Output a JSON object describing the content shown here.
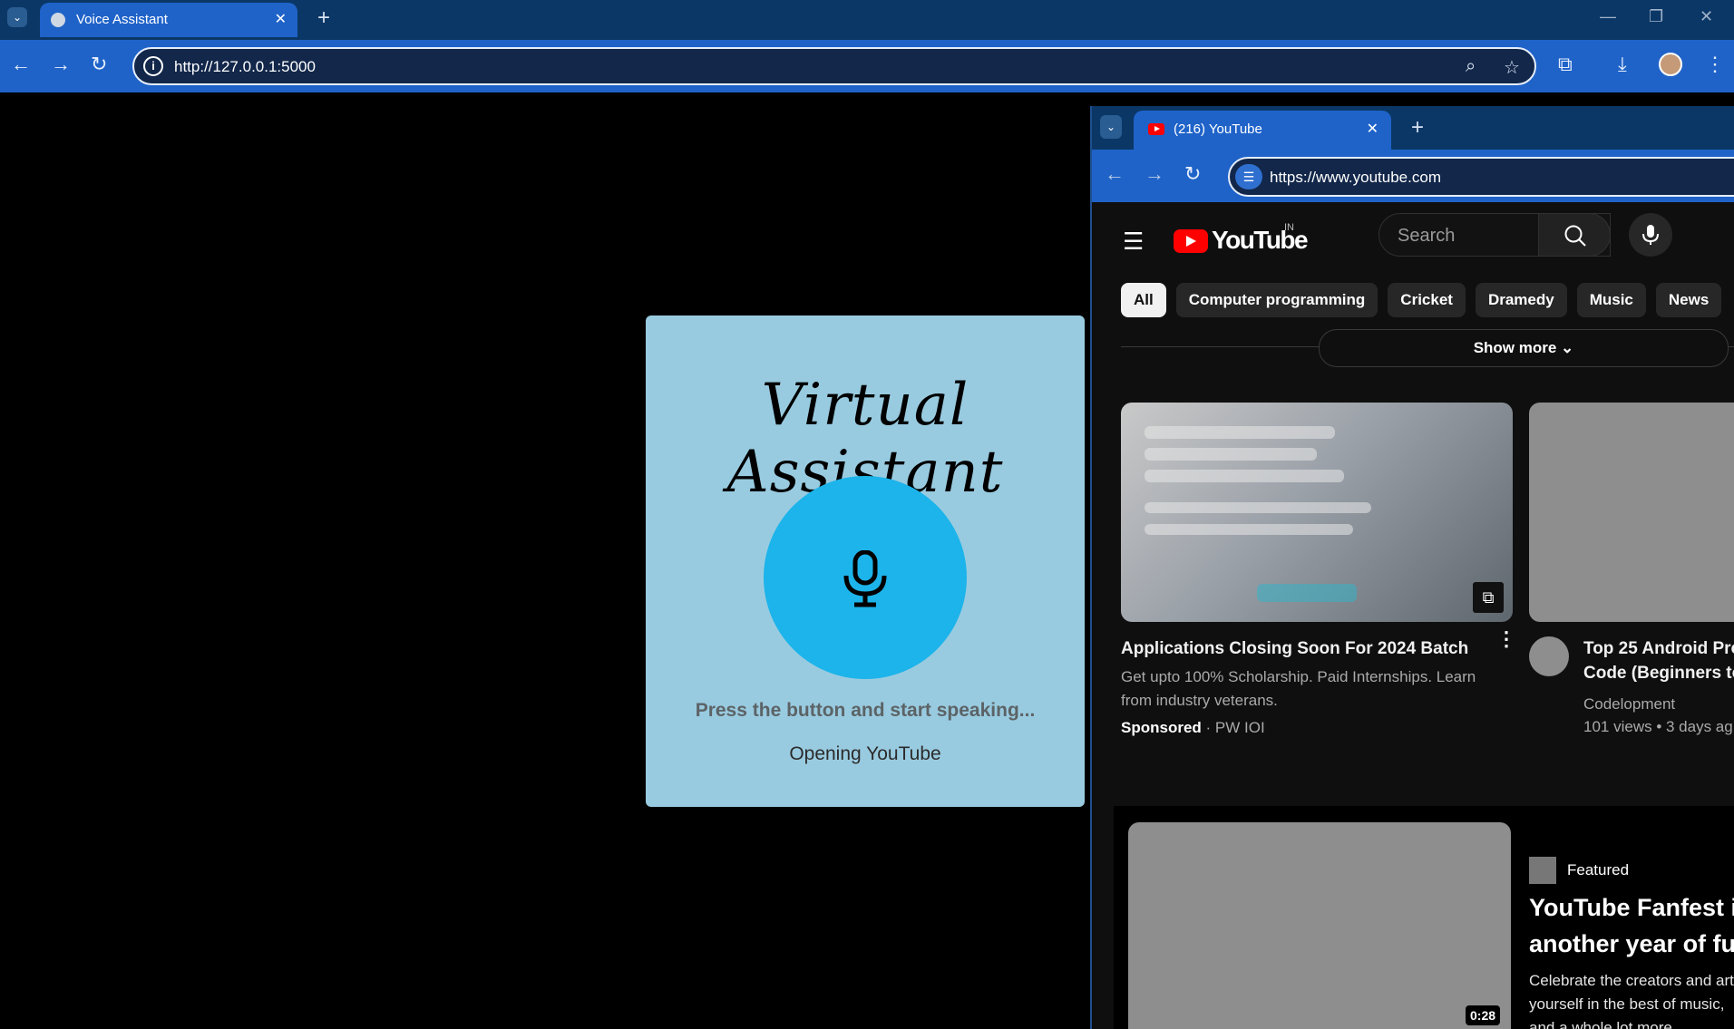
{
  "browser": {
    "tab_title": "Voice Assistant",
    "url": "http://127.0.0.1:5000",
    "new_tab": "+",
    "tab_close": "✕"
  },
  "assistant": {
    "title": "Virtual Assistant",
    "prompt": "Press the button and start speaking...",
    "status": "Opening YouTube"
  },
  "youtube_window": {
    "tab_title": "(216) YouTube",
    "url": "https://www.youtube.com",
    "logo_text": "YouTube",
    "country_code": "IN",
    "search_placeholder": "Search",
    "chips": [
      "All",
      "Computer programming",
      "Cricket",
      "Dramedy",
      "Music",
      "News"
    ],
    "show_more": "Show more",
    "videos": [
      {
        "title": "Applications Closing Soon For 2024 Batch",
        "description_line1": "Get upto 100% Scholarship. Paid Internships. Learn",
        "description_line2": "from industry veterans.",
        "sponsored": "Sponsored",
        "advertiser": "· PW IOI"
      },
      {
        "title_line1": "Top 25 Android Pro",
        "title_line2": "Code (Beginners to",
        "channel": "Codelopment",
        "meta": "101 views • 3 days ag"
      }
    ],
    "featured": {
      "label": "Featured",
      "duration": "0:28",
      "title_line1": "YouTube Fanfest i",
      "title_line2": "another year of fu",
      "desc_line1": "Celebrate the creators and art",
      "desc_line2": "yourself in the best of music,",
      "desc_line3": "and a whole lot more."
    }
  },
  "colors": {
    "chrome_tabbar": "#0b3766",
    "chrome_toolbar": "#1f63c9",
    "card_background": "#99cbe0",
    "mic_button": "#1cb4ea",
    "youtube_red": "#ff0000"
  },
  "icons": [
    "tab-dropdown-icon",
    "globe-icon",
    "close-icon",
    "back-icon",
    "forward-icon",
    "reload-icon",
    "info-icon",
    "zoom-icon",
    "star-icon",
    "extensions-icon",
    "download-icon",
    "menu-dots-icon",
    "microphone-icon",
    "hamburger-icon",
    "search-icon",
    "external-link-icon"
  ]
}
